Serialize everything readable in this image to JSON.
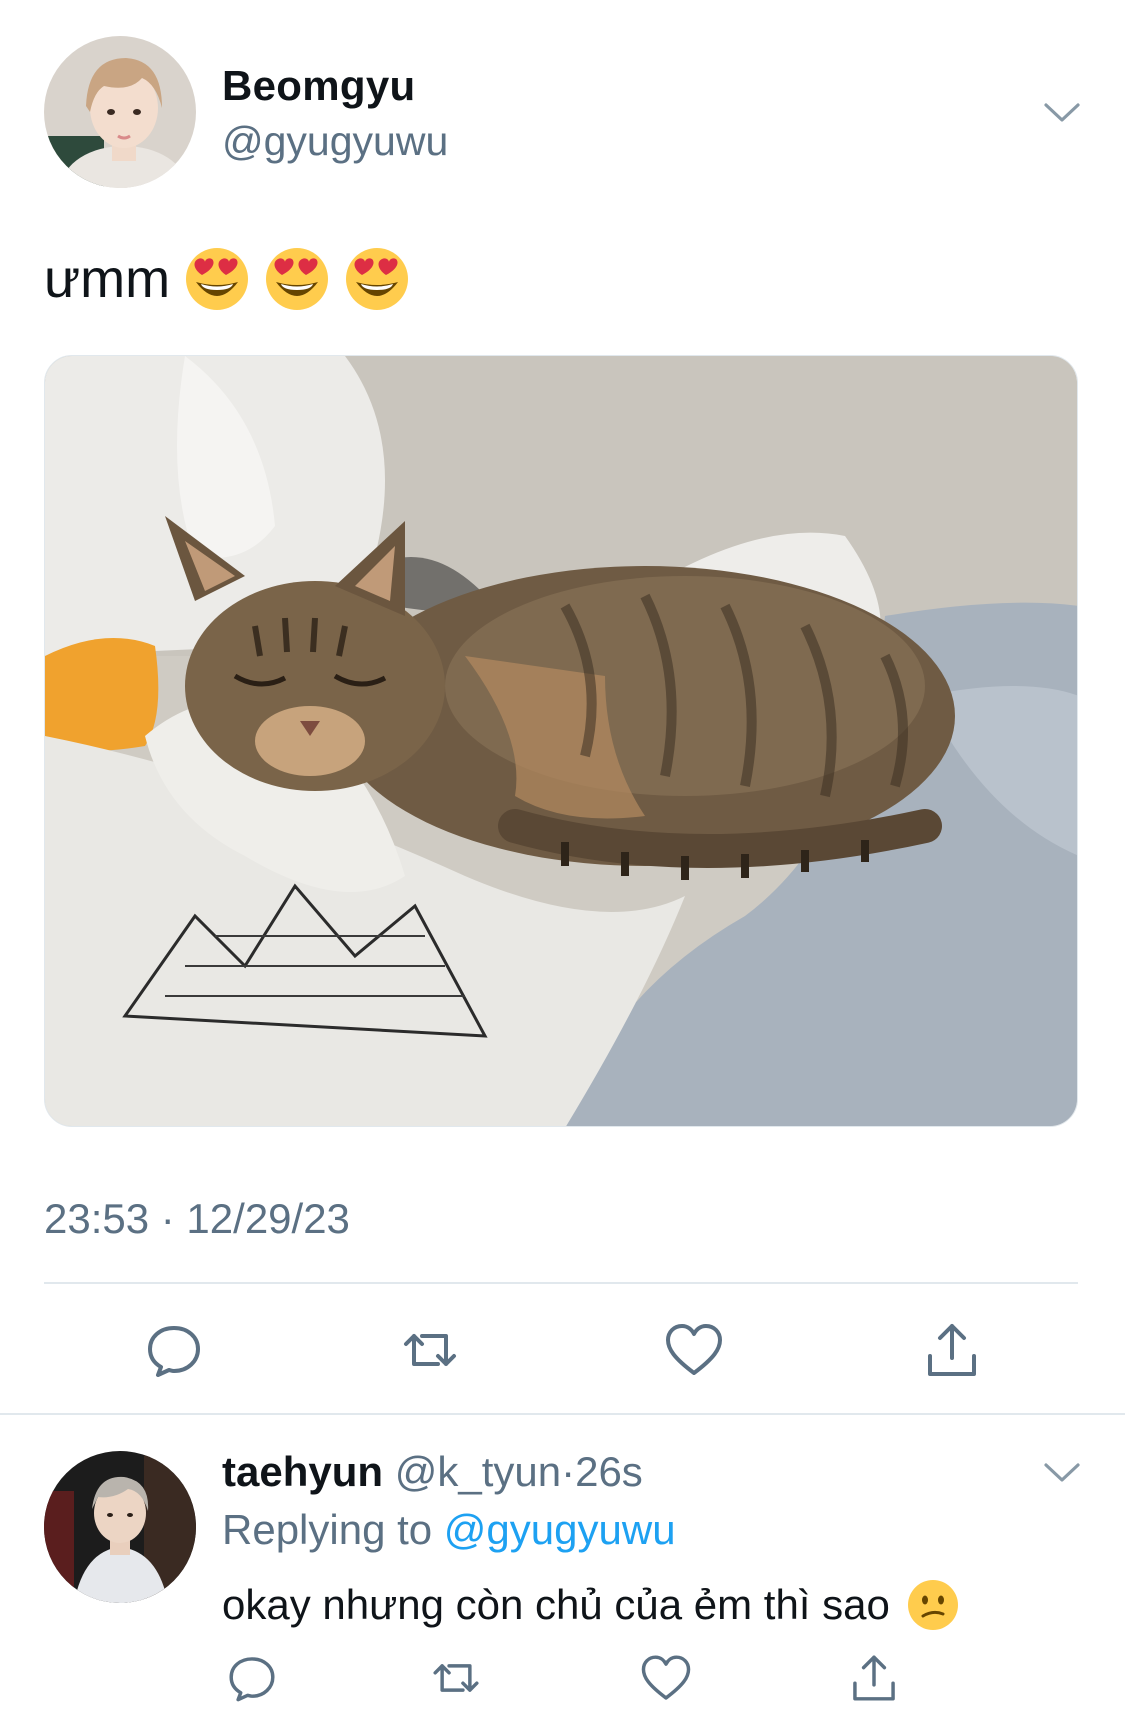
{
  "tweet": {
    "author_name": "Beomgyu",
    "author_handle": "@gyugyuwu",
    "text": "ưmm",
    "emojis": [
      "heart-eyes-emoji",
      "heart-eyes-emoji",
      "heart-eyes-emoji"
    ],
    "timestamp": "23:53 · 12/29/23",
    "photo_subject": "tabby-cat-sleeping-on-bed",
    "actions": [
      "reply-icon",
      "retweet-icon",
      "like-icon",
      "share-icon"
    ]
  },
  "reply": {
    "author_name": "taehyun",
    "author_handle": "@k_tyun",
    "separator": "·",
    "age": "26s",
    "replying_prefix": "Replying to",
    "replying_mention": "@gyugyuwu",
    "text": "okay nhưng còn chủ của ẻm thì sao",
    "emoji": "confused-face-emoji",
    "actions": [
      "reply-icon",
      "retweet-icon",
      "like-icon",
      "share-icon"
    ]
  },
  "colors": {
    "primary_text": "#0f1419",
    "secondary_text": "#5b7083",
    "link": "#1da1f2",
    "divider": "#e1e8ed",
    "icon": "#5b7083"
  }
}
